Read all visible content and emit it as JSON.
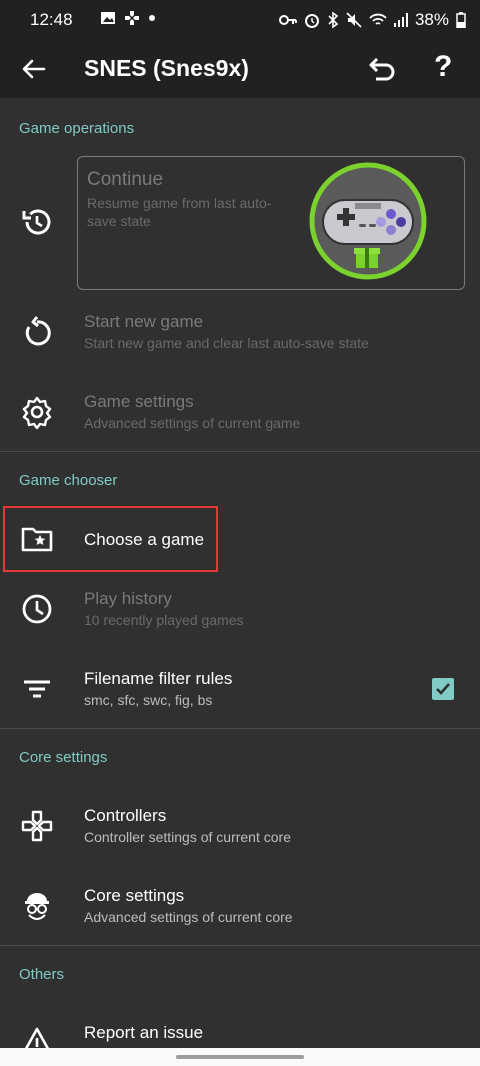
{
  "status": {
    "time": "12:48",
    "battery": "38%",
    "left_icons": [
      "image-icon",
      "gamepad-icon",
      "dot-icon"
    ],
    "right_icons": [
      "key-icon",
      "alarm-icon",
      "bluetooth-icon",
      "mute-icon",
      "wifi-icon",
      "signal-icon",
      "battery-icon"
    ]
  },
  "appbar": {
    "title": "SNES (Snes9x)",
    "help_label": "?"
  },
  "sections": {
    "game_operations": "Game operations",
    "game_chooser": "Game chooser",
    "core_settings": "Core settings",
    "others": "Others"
  },
  "continue": {
    "title": "Continue",
    "subtitle": "Resume game from last auto-save state"
  },
  "items": {
    "start_new": {
      "title": "Start new game",
      "subtitle": "Start new game and clear last auto-save state"
    },
    "game_settings": {
      "title": "Game settings",
      "subtitle": "Advanced settings of current game"
    },
    "choose_game": {
      "title": "Choose a game"
    },
    "play_history": {
      "title": "Play history",
      "subtitle": "10 recently played games"
    },
    "filename_filter": {
      "title": "Filename filter rules",
      "subtitle": "smc, sfc, swc, fig, bs",
      "checked": true
    },
    "controllers": {
      "title": "Controllers",
      "subtitle": "Controller settings of current core"
    },
    "core_settings": {
      "title": "Core settings",
      "subtitle": "Advanced settings of current core"
    },
    "report_issue": {
      "title": "Report an issue"
    }
  },
  "colors": {
    "accent": "#80cbc4",
    "highlight": "#e53935",
    "background": "#303030",
    "appbar": "#212121"
  }
}
